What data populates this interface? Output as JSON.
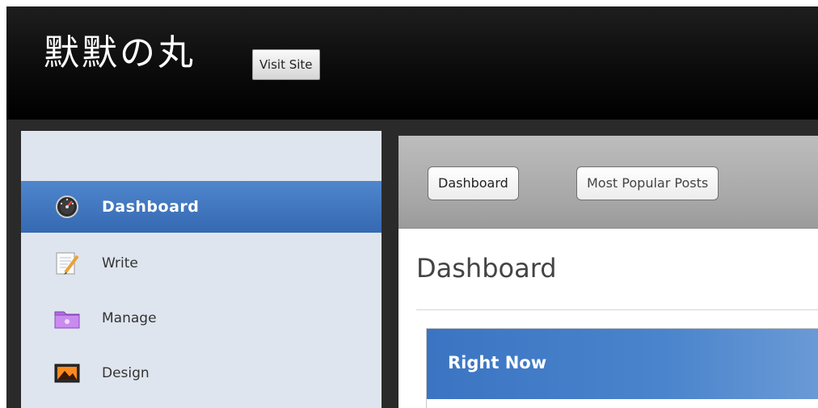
{
  "header": {
    "site_title": "默默の丸",
    "visit_site_label": "Visit Site"
  },
  "sidebar": {
    "items": [
      {
        "label": "Dashboard",
        "icon": "dashboard-gauge-icon",
        "active": true
      },
      {
        "label": "Write",
        "icon": "write-notepad-icon",
        "active": false
      },
      {
        "label": "Manage",
        "icon": "manage-folder-icon",
        "active": false
      },
      {
        "label": "Design",
        "icon": "design-image-icon",
        "active": false
      }
    ]
  },
  "tabs": [
    {
      "label": "Dashboard"
    },
    {
      "label": "Most Popular Posts"
    }
  ],
  "main": {
    "page_title": "Dashboard",
    "widget_title": "Right Now"
  },
  "colors": {
    "header_bg": "#0a0a0a",
    "sidebar_bg": "#dfe5ee",
    "active_item": "#3f78c0",
    "widget_header": "#3b74c2"
  }
}
